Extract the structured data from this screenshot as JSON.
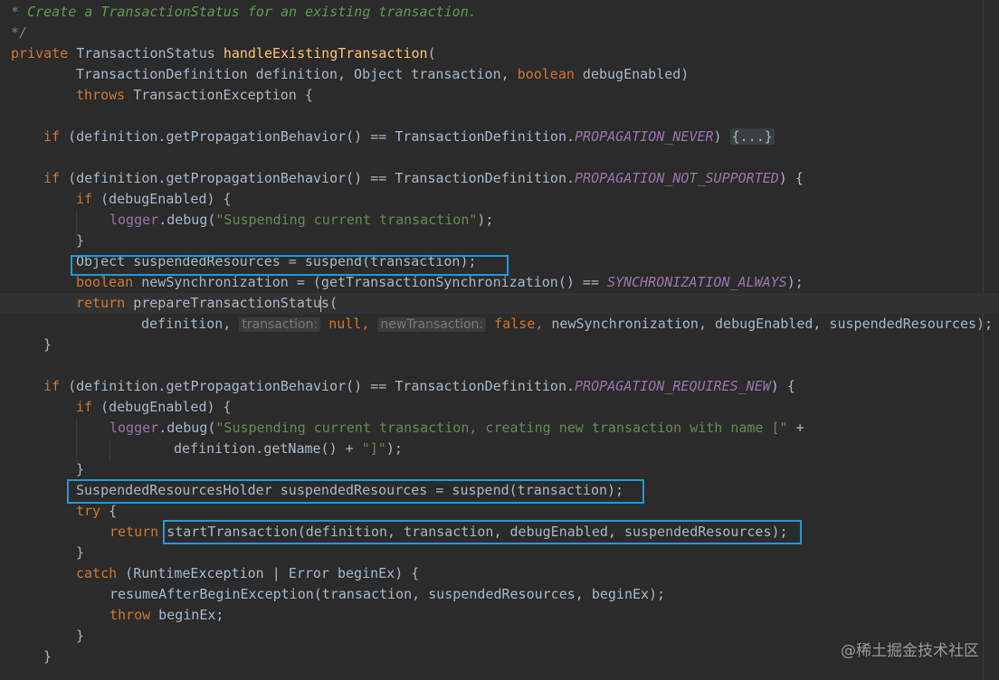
{
  "lines": {
    "l1": "* Create a TransactionStatus for an existing transaction.",
    "l2": "*/",
    "l3_private": "private",
    "l3_type": " TransactionStatus ",
    "l3_name": "handleExistingTransaction",
    "l3_paren": "(",
    "l4_a": "TransactionDefinition definition, Object transaction, ",
    "l4_kw": "boolean",
    "l4_b": " debugEnabled)",
    "l5_kw": "throws",
    "l5_b": " TransactionException {",
    "if_kw": "if",
    "l7_a": " (definition.getPropagationBehavior() == TransactionDefinition.",
    "l7_const": "PROPAGATION_NEVER",
    "l7_b": ") ",
    "l7_fold": "{...}",
    "l9_a": " (definition.getPropagationBehavior() == TransactionDefinition.",
    "l9_const": "PROPAGATION_NOT_SUPPORTED",
    "l9_b": ") {",
    "l10_b": " (debugEnabled) {",
    "logger": "logger",
    "l11_a": ".debug(",
    "l11_str": "\"Suspending current transaction\"",
    "l11_b": ");",
    "close_brace": "}",
    "l13": "Object suspendedResources = suspend(transaction);",
    "l14_kw": "boolean",
    "l14_a": " newSynchronization = (getTransactionSynchronization() == ",
    "l14_const": "SYNCHRONIZATION_ALWAYS",
    "l14_b": ");",
    "return_kw": "return",
    "l15_a": " prepareTransactionStatus(",
    "l16_a": "definition, ",
    "l16_hint1": "transaction:",
    "l16_null": " null, ",
    "l16_hint2": "newTransaction:",
    "l16_false": " false, ",
    "l16_b": "newSynchronization, debugEnabled, suspendedResources);",
    "l19_a": " (definition.getPropagationBehavior() == TransactionDefinition.",
    "l19_const": "PROPAGATION_REQUIRES_NEW",
    "l19_b": ") {",
    "l21_str": "\"Suspending current transaction, creating new transaction with name [\"",
    "l21_b": " +",
    "l22_a": "definition.getName() + ",
    "l22_str": "\"]\"",
    "l22_b": ");",
    "l24": "SuspendedResourcesHolder suspendedResources = suspend(transaction);",
    "try_kw": "try",
    "l25_b": " {",
    "l26_a": "startTransaction(definition, transaction, debugEnabled, suspendedResources);",
    "catch_kw": "catch",
    "l28_b": " (RuntimeException | Error beginEx) {",
    "l29": "resumeAfterBeginException(transaction, suspendedResources, beginEx);",
    "throw_kw": "throw",
    "l30_b": " beginEx;"
  },
  "watermark": "@稀土掘金技术社区",
  "colors": {
    "background": "#2b2b2b",
    "keyword": "#cc7832",
    "method_decl": "#ffc66d",
    "string": "#6a8759",
    "constant": "#9876aa",
    "highlight_box": "#1e9bd7"
  }
}
